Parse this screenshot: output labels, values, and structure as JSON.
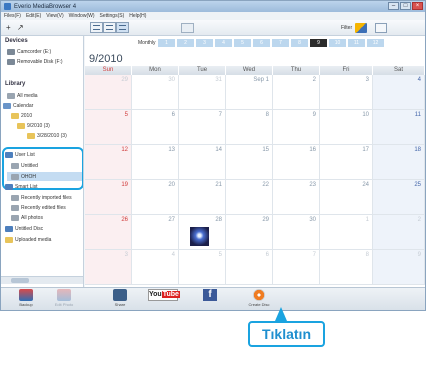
{
  "window": {
    "title": "Everio MediaBrowser 4",
    "min": "–",
    "max": "□",
    "close": "×"
  },
  "menu": [
    "Files(F)",
    "Edit(E)",
    "View(V)",
    "Window(W)",
    "Settings(S)",
    "Help(H)"
  ],
  "toolbar": {
    "add": "+",
    "sort": "↗",
    "filter_label": "Filter"
  },
  "sidebar": {
    "devices_title": "Devices",
    "devices": [
      "Camcorder (E:)",
      "Removable Disk (F:)"
    ],
    "library_title": "Library",
    "library": [
      "All media",
      "Calendar",
      "2010",
      "9/2010 (3)",
      "3/28/2010 (3)",
      "User List",
      "Untitled",
      "OHOH",
      "Smart List",
      "Recently imported files",
      "Recently edited files",
      "All photos",
      "Untitled Disc",
      "Uploaded media"
    ]
  },
  "calendar": {
    "view_label": "Monthly",
    "months": [
      "1",
      "2",
      "3",
      "4",
      "5",
      "6",
      "7",
      "8",
      "9",
      "10",
      "11",
      "12"
    ],
    "active_month_index": 8,
    "title": "9/2010",
    "weekdays": [
      "Sun",
      "Mon",
      "Tue",
      "Wed",
      "Thu",
      "Fri",
      "Sat"
    ],
    "weeks": [
      [
        "29",
        "30",
        "31",
        "Sep 1",
        "2",
        "3",
        "4"
      ],
      [
        "5",
        "6",
        "7",
        "8",
        "9",
        "10",
        "11"
      ],
      [
        "12",
        "13",
        "14",
        "15",
        "16",
        "17",
        "18"
      ],
      [
        "19",
        "20",
        "21",
        "22",
        "23",
        "24",
        "25"
      ],
      [
        "26",
        "27",
        "28",
        "29",
        "30",
        "1",
        "2"
      ],
      [
        "3",
        "4",
        "5",
        "6",
        "7",
        "8",
        "9"
      ]
    ]
  },
  "bottombar": {
    "items": [
      "Backup",
      "Edit Photo",
      "Share",
      "YouTube",
      "f",
      "Create Disc"
    ],
    "youtube_a": "You",
    "youtube_b": "Tube"
  },
  "annotation": {
    "label": "Tıklatın"
  }
}
